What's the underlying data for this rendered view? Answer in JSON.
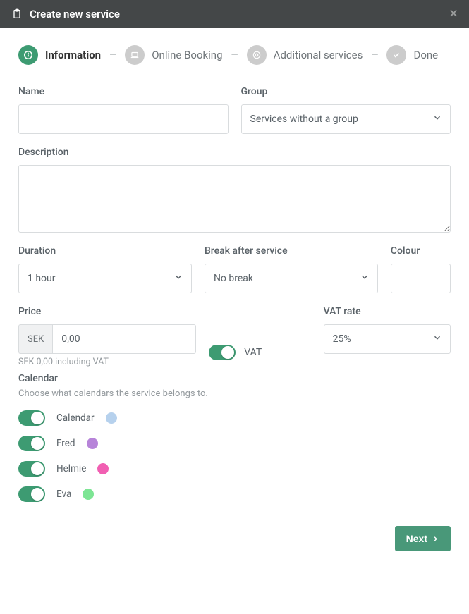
{
  "modalTitle": "Create new service",
  "wizard": {
    "step1": "Information",
    "step2": "Online Booking",
    "step3": "Additional services",
    "step4": "Done"
  },
  "labels": {
    "name": "Name",
    "group": "Group",
    "description": "Description",
    "duration": "Duration",
    "breakAfter": "Break after service",
    "colour": "Colour",
    "price": "Price",
    "vatRate": "VAT rate",
    "vat": "VAT",
    "calendar": "Calendar",
    "calendarSub": "Choose what calendars the service belongs to."
  },
  "values": {
    "group": "Services without a group",
    "duration": "1 hour",
    "breakAfter": "No break",
    "priceCurrency": "SEK",
    "priceValue": "0,00",
    "priceHint": "SEK 0,00 including VAT",
    "vatRate": "25%"
  },
  "calendars": [
    {
      "name": "Calendar",
      "color": "#b6d1ed"
    },
    {
      "name": "Fred",
      "color": "#b784d9"
    },
    {
      "name": "Helmie",
      "color": "#f15fb2"
    },
    {
      "name": "Eva",
      "color": "#7de594"
    }
  ],
  "buttons": {
    "next": "Next"
  }
}
